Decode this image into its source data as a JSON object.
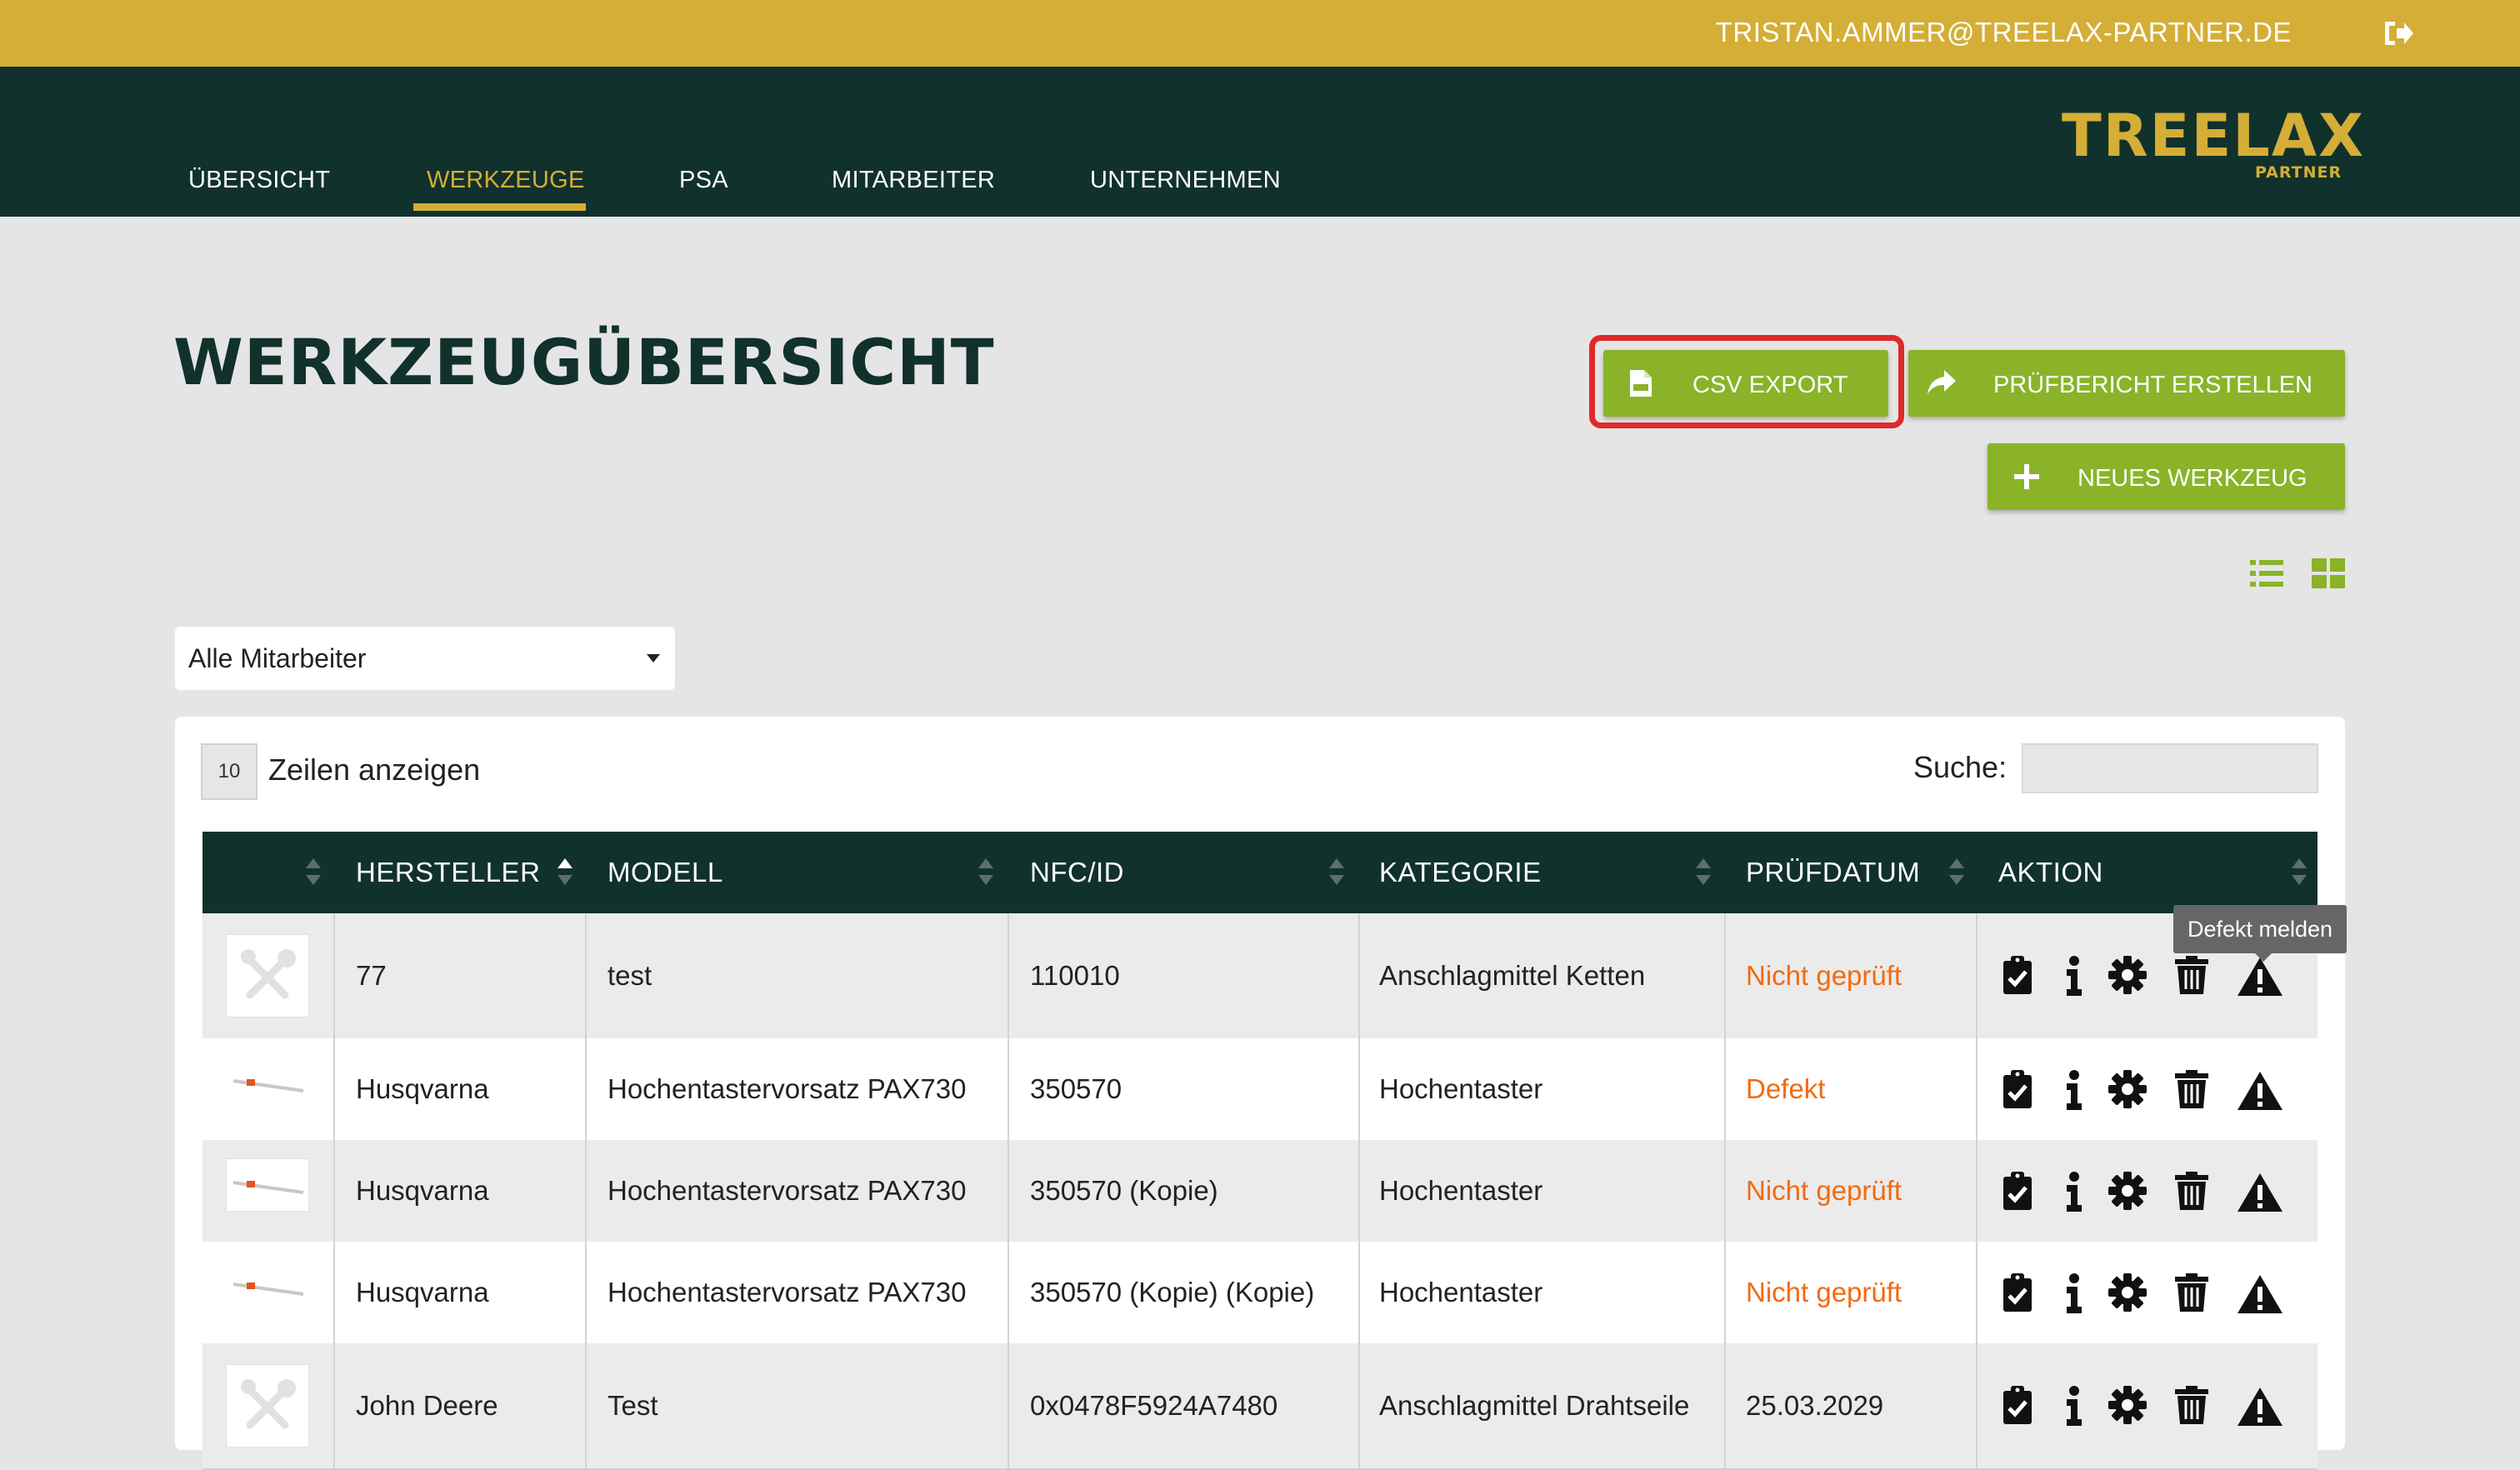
{
  "user": {
    "email": "TRISTAN.AMMER@TREELAX-PARTNER.DE"
  },
  "nav": {
    "items": [
      {
        "label": "ÜBERSICHT"
      },
      {
        "label": "WERKZEUGE"
      },
      {
        "label": "PSA"
      },
      {
        "label": "MITARBEITER"
      },
      {
        "label": "UNTERNEHMEN"
      }
    ],
    "active": "WERKZEUGE"
  },
  "logo": {
    "main": "TREELAX",
    "sub": "PARTNER"
  },
  "page": {
    "title": "WERKZEUGÜBERSICHT"
  },
  "buttons": {
    "csv_export": "CSV EXPORT",
    "report": "PRÜFBERICHT ERSTELLEN",
    "new_tool": "NEUES WERKZEUG"
  },
  "filter": {
    "employee_select": "Alle Mitarbeiter"
  },
  "table_controls": {
    "page_length": "10",
    "page_length_label": "Zeilen anzeigen",
    "search_label": "Suche:"
  },
  "table": {
    "columns": [
      "HERSTELLER",
      "MODELL",
      "NFC/ID",
      "KATEGORIE",
      "PRÜFDATUM",
      "AKTION"
    ],
    "rows": [
      {
        "hersteller": "77",
        "modell": "test",
        "nfc": "110010",
        "kategorie": "Anschlagmittel Ketten",
        "pruefdatum": "Nicht geprüft"
      },
      {
        "hersteller": "Husqvarna",
        "modell": "Hochentastervorsatz PAX730",
        "nfc": "350570",
        "kategorie": "Hochentaster",
        "pruefdatum": "Defekt"
      },
      {
        "hersteller": "Husqvarna",
        "modell": "Hochentastervorsatz PAX730",
        "nfc": "350570 (Kopie)",
        "kategorie": "Hochentaster",
        "pruefdatum": "Nicht geprüft"
      },
      {
        "hersteller": "Husqvarna",
        "modell": "Hochentastervorsatz PAX730",
        "nfc": "350570 (Kopie) (Kopie)",
        "kategorie": "Hochentaster",
        "pruefdatum": "Nicht geprüft"
      },
      {
        "hersteller": "John Deere",
        "modell": "Test",
        "nfc": "0x0478F5924A7480",
        "kategorie": "Anschlagmittel Drahtseile",
        "pruefdatum": "25.03.2029"
      }
    ]
  },
  "tooltip": {
    "text": "Defekt melden"
  },
  "colors": {
    "brand_gold": "#d4ae36",
    "nav_dark": "#11312c",
    "action_green": "#8ab329",
    "warning_orange": "#f26a10"
  },
  "icons": {
    "logout": "logout-icon",
    "csv": "csv-file-icon",
    "share": "share-icon",
    "plus": "plus-icon",
    "list_view": "list-view-icon",
    "grid_view": "grid-view-icon",
    "actions": [
      "clipboard-check-icon",
      "info-icon",
      "gear-icon",
      "trash-icon",
      "warning-icon"
    ]
  }
}
